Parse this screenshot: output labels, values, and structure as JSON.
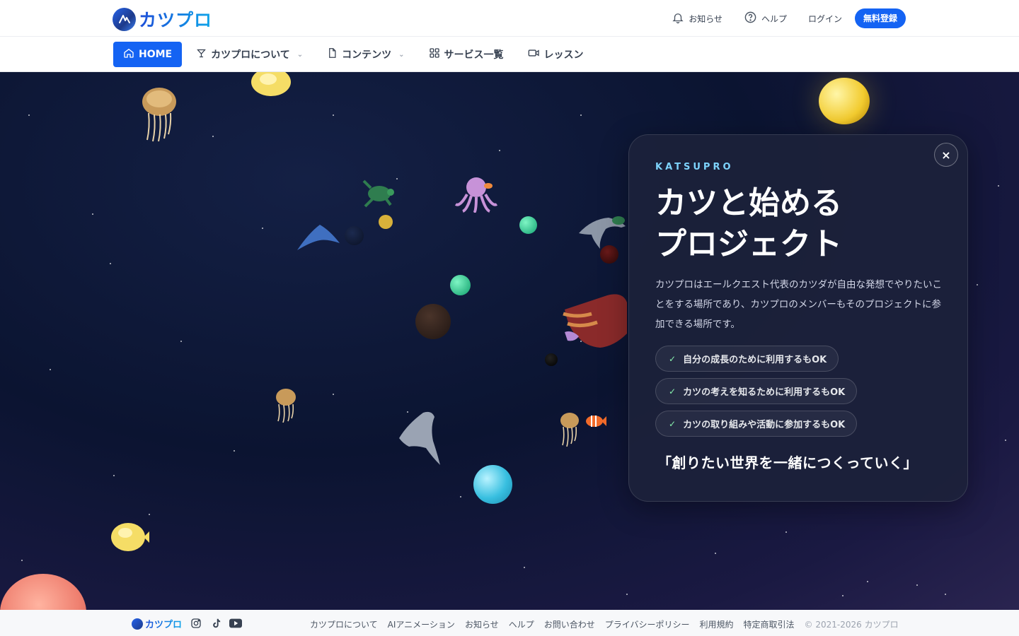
{
  "brand": {
    "name": "カツプロ",
    "accent": "#1463f3"
  },
  "header": {
    "links": [
      {
        "label": "お知らせ",
        "icon": "bell-icon"
      },
      {
        "label": "ヘルプ",
        "icon": "help-circle-icon"
      },
      {
        "label": "ログイン"
      }
    ],
    "register_label": "無料登録"
  },
  "nav": {
    "items": [
      {
        "label": "HOME",
        "icon": "home-icon",
        "active": true
      },
      {
        "label": "カツプロについて",
        "icon": "cocktail-icon",
        "dropdown": true
      },
      {
        "label": "コンテンツ",
        "icon": "document-icon",
        "dropdown": true
      },
      {
        "label": "サービス一覧",
        "icon": "grid-icon"
      },
      {
        "label": "レッスン",
        "icon": "video-camera-icon"
      }
    ]
  },
  "hero": {
    "eyebrow": "KATSUPRO",
    "title_line1": "カツと始める",
    "title_line2": "プロジェクト",
    "description": "カツプロはエールクエスト代表のカツダが自由な発想でやりたいことをする場所であり、カツプロのメンバーもそのプロジェクトに参加できる場所です。",
    "benefits": [
      "自分の成長のために利用するもOK",
      "カツの考えを知るために利用するもOK",
      "カツの取り組みや活動に参加するもOK"
    ],
    "slogan": "「創りたい世界を一緒につくっていく」",
    "close_label": "×"
  },
  "footer": {
    "social": [
      "instagram-icon",
      "tiktok-icon",
      "youtube-icon"
    ],
    "links": [
      "カツプロについて",
      "AIアニメーション",
      "お知らせ",
      "ヘルプ",
      "お問い合わせ",
      "プライバシーポリシー",
      "利用規約",
      "特定商取引法"
    ],
    "copyright": "© 2021-2026 カツプロ"
  }
}
